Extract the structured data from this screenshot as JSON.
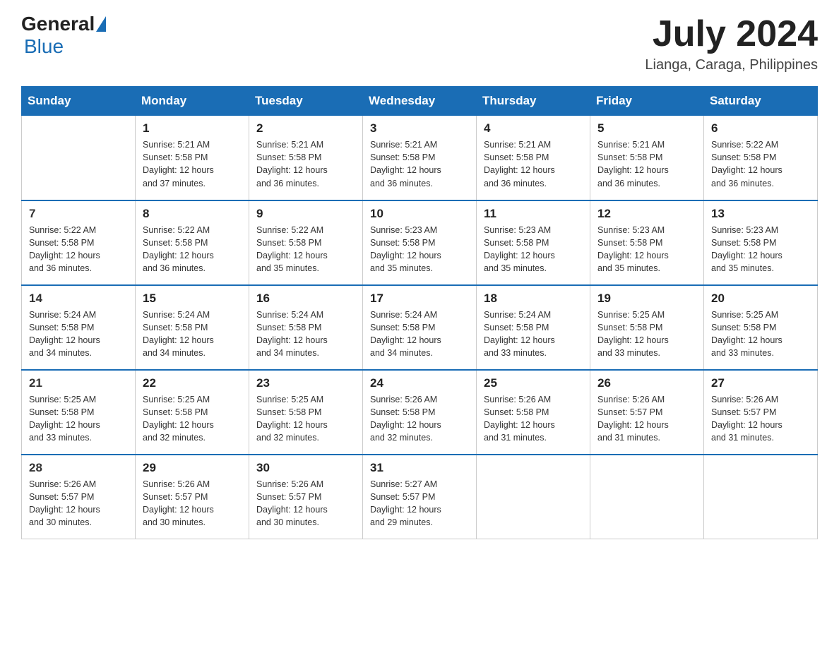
{
  "logo": {
    "general": "General",
    "blue": "Blue"
  },
  "header": {
    "month": "July 2024",
    "location": "Lianga, Caraga, Philippines"
  },
  "days_of_week": [
    "Sunday",
    "Monday",
    "Tuesday",
    "Wednesday",
    "Thursday",
    "Friday",
    "Saturday"
  ],
  "weeks": [
    [
      {
        "day": "",
        "info": ""
      },
      {
        "day": "1",
        "info": "Sunrise: 5:21 AM\nSunset: 5:58 PM\nDaylight: 12 hours\nand 37 minutes."
      },
      {
        "day": "2",
        "info": "Sunrise: 5:21 AM\nSunset: 5:58 PM\nDaylight: 12 hours\nand 36 minutes."
      },
      {
        "day": "3",
        "info": "Sunrise: 5:21 AM\nSunset: 5:58 PM\nDaylight: 12 hours\nand 36 minutes."
      },
      {
        "day": "4",
        "info": "Sunrise: 5:21 AM\nSunset: 5:58 PM\nDaylight: 12 hours\nand 36 minutes."
      },
      {
        "day": "5",
        "info": "Sunrise: 5:21 AM\nSunset: 5:58 PM\nDaylight: 12 hours\nand 36 minutes."
      },
      {
        "day": "6",
        "info": "Sunrise: 5:22 AM\nSunset: 5:58 PM\nDaylight: 12 hours\nand 36 minutes."
      }
    ],
    [
      {
        "day": "7",
        "info": "Sunrise: 5:22 AM\nSunset: 5:58 PM\nDaylight: 12 hours\nand 36 minutes."
      },
      {
        "day": "8",
        "info": "Sunrise: 5:22 AM\nSunset: 5:58 PM\nDaylight: 12 hours\nand 36 minutes."
      },
      {
        "day": "9",
        "info": "Sunrise: 5:22 AM\nSunset: 5:58 PM\nDaylight: 12 hours\nand 35 minutes."
      },
      {
        "day": "10",
        "info": "Sunrise: 5:23 AM\nSunset: 5:58 PM\nDaylight: 12 hours\nand 35 minutes."
      },
      {
        "day": "11",
        "info": "Sunrise: 5:23 AM\nSunset: 5:58 PM\nDaylight: 12 hours\nand 35 minutes."
      },
      {
        "day": "12",
        "info": "Sunrise: 5:23 AM\nSunset: 5:58 PM\nDaylight: 12 hours\nand 35 minutes."
      },
      {
        "day": "13",
        "info": "Sunrise: 5:23 AM\nSunset: 5:58 PM\nDaylight: 12 hours\nand 35 minutes."
      }
    ],
    [
      {
        "day": "14",
        "info": "Sunrise: 5:24 AM\nSunset: 5:58 PM\nDaylight: 12 hours\nand 34 minutes."
      },
      {
        "day": "15",
        "info": "Sunrise: 5:24 AM\nSunset: 5:58 PM\nDaylight: 12 hours\nand 34 minutes."
      },
      {
        "day": "16",
        "info": "Sunrise: 5:24 AM\nSunset: 5:58 PM\nDaylight: 12 hours\nand 34 minutes."
      },
      {
        "day": "17",
        "info": "Sunrise: 5:24 AM\nSunset: 5:58 PM\nDaylight: 12 hours\nand 34 minutes."
      },
      {
        "day": "18",
        "info": "Sunrise: 5:24 AM\nSunset: 5:58 PM\nDaylight: 12 hours\nand 33 minutes."
      },
      {
        "day": "19",
        "info": "Sunrise: 5:25 AM\nSunset: 5:58 PM\nDaylight: 12 hours\nand 33 minutes."
      },
      {
        "day": "20",
        "info": "Sunrise: 5:25 AM\nSunset: 5:58 PM\nDaylight: 12 hours\nand 33 minutes."
      }
    ],
    [
      {
        "day": "21",
        "info": "Sunrise: 5:25 AM\nSunset: 5:58 PM\nDaylight: 12 hours\nand 33 minutes."
      },
      {
        "day": "22",
        "info": "Sunrise: 5:25 AM\nSunset: 5:58 PM\nDaylight: 12 hours\nand 32 minutes."
      },
      {
        "day": "23",
        "info": "Sunrise: 5:25 AM\nSunset: 5:58 PM\nDaylight: 12 hours\nand 32 minutes."
      },
      {
        "day": "24",
        "info": "Sunrise: 5:26 AM\nSunset: 5:58 PM\nDaylight: 12 hours\nand 32 minutes."
      },
      {
        "day": "25",
        "info": "Sunrise: 5:26 AM\nSunset: 5:58 PM\nDaylight: 12 hours\nand 31 minutes."
      },
      {
        "day": "26",
        "info": "Sunrise: 5:26 AM\nSunset: 5:57 PM\nDaylight: 12 hours\nand 31 minutes."
      },
      {
        "day": "27",
        "info": "Sunrise: 5:26 AM\nSunset: 5:57 PM\nDaylight: 12 hours\nand 31 minutes."
      }
    ],
    [
      {
        "day": "28",
        "info": "Sunrise: 5:26 AM\nSunset: 5:57 PM\nDaylight: 12 hours\nand 30 minutes."
      },
      {
        "day": "29",
        "info": "Sunrise: 5:26 AM\nSunset: 5:57 PM\nDaylight: 12 hours\nand 30 minutes."
      },
      {
        "day": "30",
        "info": "Sunrise: 5:26 AM\nSunset: 5:57 PM\nDaylight: 12 hours\nand 30 minutes."
      },
      {
        "day": "31",
        "info": "Sunrise: 5:27 AM\nSunset: 5:57 PM\nDaylight: 12 hours\nand 29 minutes."
      },
      {
        "day": "",
        "info": ""
      },
      {
        "day": "",
        "info": ""
      },
      {
        "day": "",
        "info": ""
      }
    ]
  ]
}
